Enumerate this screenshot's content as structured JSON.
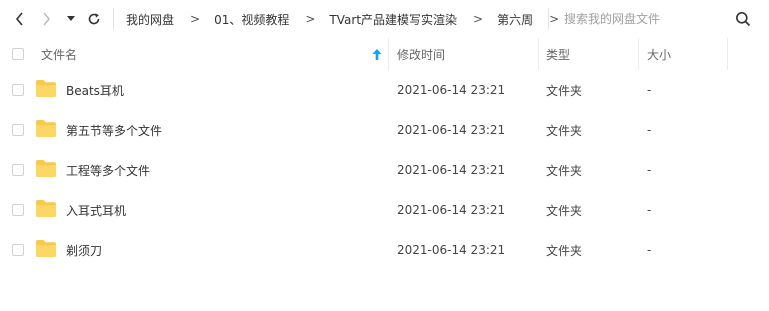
{
  "toolbar": {
    "back_icon": "chevron-left-icon",
    "forward_icon": "chevron-right-icon",
    "history_dropdown_icon": "caret-down-icon",
    "refresh_icon": "refresh-icon",
    "search_icon": "search-icon"
  },
  "breadcrumb": {
    "items": [
      "我的网盘",
      "01、视频教程",
      "TVart产品建模写实渲染",
      "第六周"
    ],
    "separator": ">"
  },
  "search": {
    "placeholder": "搜索我的网盘文件",
    "value": ""
  },
  "table": {
    "columns": {
      "name": "文件名",
      "modified": "修改时间",
      "type": "类型",
      "size": "大小"
    },
    "sort_icon": "sort-up-arrow-icon",
    "rows": [
      {
        "name": "Beats耳机",
        "modified": "2021-06-14 23:21",
        "type": "文件夹",
        "size": "-"
      },
      {
        "name": "第五节等多个文件",
        "modified": "2021-06-14 23:21",
        "type": "文件夹",
        "size": "-"
      },
      {
        "name": "工程等多个文件",
        "modified": "2021-06-14 23:21",
        "type": "文件夹",
        "size": "-"
      },
      {
        "name": "入耳式耳机",
        "modified": "2021-06-14 23:21",
        "type": "文件夹",
        "size": "-"
      },
      {
        "name": "剃须刀",
        "modified": "2021-06-14 23:21",
        "type": "文件夹",
        "size": "-"
      }
    ]
  },
  "colors": {
    "folder": "#f8c94c",
    "sort_accent": "#06a7ff"
  }
}
